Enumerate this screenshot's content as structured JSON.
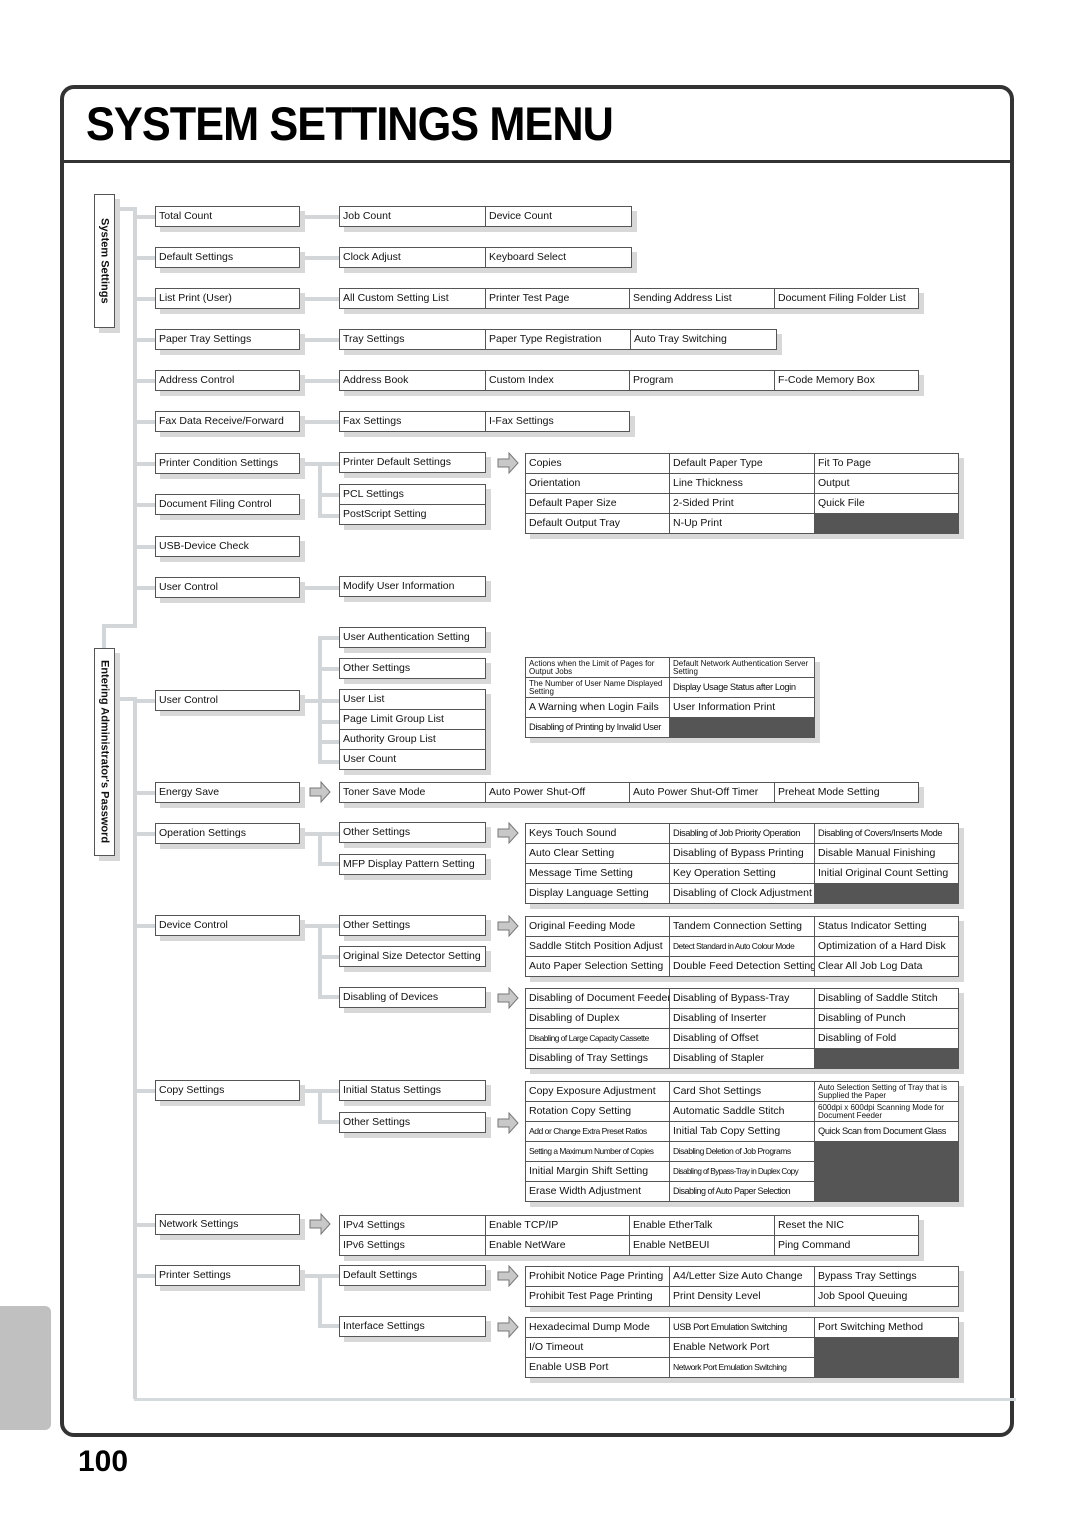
{
  "page": {
    "title": "SYSTEM SETTINGS MENU",
    "page_number": "100"
  },
  "sections": {
    "system_settings": "System Settings",
    "admin_password": "Entering Administrator's Password"
  },
  "rows": {
    "total_count": {
      "label": "Total Count",
      "children": [
        "Job Count",
        "Device Count"
      ]
    },
    "default_settings": {
      "label": "Default Settings",
      "children": [
        "Clock Adjust",
        "Keyboard Select"
      ]
    },
    "list_print": {
      "label": "List Print (User)",
      "children": [
        "All Custom Setting List",
        "Printer Test Page",
        "Sending Address List",
        "Document Filing Folder List"
      ]
    },
    "paper_tray": {
      "label": "Paper Tray Settings",
      "children": [
        "Tray Settings",
        "Paper Type Registration",
        "Auto Tray Switching"
      ]
    },
    "address_control": {
      "label": "Address Control",
      "children": [
        "Address Book",
        "Custom Index",
        "Program",
        "F-Code Memory Box"
      ]
    },
    "fax_data": {
      "label": "Fax Data Receive/Forward",
      "children": [
        "Fax Settings",
        "I-Fax Settings"
      ]
    },
    "printer_condition": {
      "label": "Printer Condition Settings",
      "sub": [
        "Printer Default Settings",
        "PCL Settings",
        "PostScript Setting"
      ],
      "detail": [
        "Copies",
        "Default Paper Type",
        "Fit To Page",
        "Orientation",
        "Line Thickness",
        "Output",
        "Default Paper Size",
        "2-Sided Print",
        "Quick File",
        "Default Output Tray",
        "N-Up Print"
      ]
    },
    "document_filing": {
      "label": "Document Filing Control"
    },
    "usb_device": {
      "label": "USB-Device Check"
    },
    "user_control_1": {
      "label": "User Control",
      "children": [
        "Modify User Information"
      ]
    },
    "user_control_2": {
      "label": "User Control",
      "sub": [
        "User Authentication Setting",
        "Other Settings",
        "User List",
        "Page Limit Group List",
        "Authority Group List",
        "User Count"
      ],
      "detail": [
        "Actions when the Limit of Pages for Output Jobs",
        "Default Network Authentication Server Setting",
        "The Number of User Name Displayed Setting",
        "Display Usage Status after Login",
        "A Warning when Login Fails",
        "User Information Print",
        "Disabling of Printing by Invalid User"
      ]
    },
    "energy_save": {
      "label": "Energy Save",
      "children": [
        "Toner Save Mode",
        "Auto Power Shut-Off",
        "Auto Power Shut-Off Timer",
        "Preheat Mode Setting"
      ]
    },
    "operation": {
      "label": "Operation Settings",
      "sub": [
        "Other Settings",
        "MFP Display Pattern Setting"
      ],
      "detail": [
        "Keys Touch Sound",
        "Disabling of Job Priority Operation",
        "Disabling of Covers/Inserts Mode",
        "Auto Clear Setting",
        "Disabling of Bypass Printing",
        "Disable Manual Finishing",
        "Message Time Setting",
        "Key Operation Setting",
        "Initial Original Count Setting",
        "Display Language Setting",
        "Disabling of Clock Adjustment"
      ]
    },
    "device_control": {
      "label": "Device Control",
      "sub": [
        "Other Settings",
        "Original Size Detector Setting",
        "Disabling of Devices"
      ],
      "detail_other": [
        "Original Feeding Mode",
        "Tandem Connection Setting",
        "Status Indicator Setting",
        "Saddle Stitch Position Adjust",
        "Detect Standard in Auto Colour Mode",
        "Optimization of a Hard Disk",
        "Auto Paper Selection Setting",
        "Double Feed Detection Setting",
        "Clear All Job Log Data"
      ],
      "detail_disabling": [
        "Disabling of Document Feeder",
        "Disabling of Bypass-Tray",
        "Disabling of Saddle Stitch",
        "Disabling of Duplex",
        "Disabling of Inserter",
        "Disabling of Punch",
        "Disabling of Large Capacity Cassette",
        "Disabling of Offset",
        "Disabling of Fold",
        "Disabling of Tray Settings",
        "Disabling of Stapler"
      ]
    },
    "copy_settings": {
      "label": "Copy Settings",
      "sub": [
        "Initial Status Settings",
        "Other Settings"
      ],
      "detail": [
        "Copy Exposure Adjustment",
        "Card Shot Settings",
        "Auto Selection Setting of Tray that is Supplied the Paper",
        "Rotation Copy Setting",
        "Automatic Saddle Stitch",
        "600dpi x 600dpi Scanning Mode for Document Feeder",
        "Add or Change Extra Preset Ratios",
        "Initial Tab Copy Setting",
        "Quick Scan from Document Glass",
        "Setting a Maximum Number of Copies",
        "Disabling Deletion of Job Programs",
        "Initial Margin Shift Setting",
        "Disabling of Bypass-Tray in Duplex Copy",
        "Erase Width Adjustment",
        "Disabling of Auto Paper Selection"
      ]
    },
    "network": {
      "label": "Network Settings",
      "detail": [
        "IPv4 Settings",
        "Enable TCP/IP",
        "Enable EtherTalk",
        "Reset the NIC",
        "IPv6 Settings",
        "Enable NetWare",
        "Enable NetBEUI",
        "Ping Command"
      ]
    },
    "printer_settings": {
      "label": "Printer Settings",
      "sub": [
        "Default Settings",
        "Interface Settings"
      ],
      "detail_default": [
        "Prohibit Notice Page Printing",
        "A4/Letter Size Auto Change",
        "Bypass Tray Settings",
        "Prohibit Test Page Printing",
        "Print Density Level",
        "Job Spool Queuing"
      ],
      "detail_interface": [
        "Hexadecimal Dump Mode",
        "USB Port Emulation Switching",
        "Port Switching Method",
        "I/O Timeout",
        "Enable Network Port",
        "Enable USB Port",
        "Network Port Emulation Switching"
      ]
    }
  },
  "colors": {
    "frame": "#333333",
    "connector": "#d3d6d8",
    "shadow": "#d8d8d8",
    "side_tab": "#c0c0c0"
  }
}
